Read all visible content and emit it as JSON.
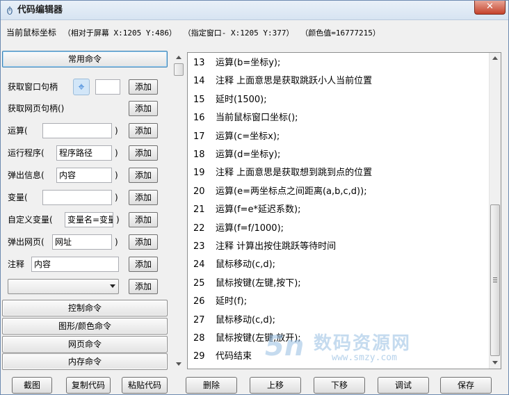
{
  "window": {
    "title": "代码编辑器",
    "icon": "app-icon",
    "close_label": "✕"
  },
  "coord_bar": {
    "label": "当前鼠标坐标",
    "screen": "（相对于屏幕 X:1205 Y:486）",
    "window": "（指定窗口- X:1205 Y:377）",
    "color": "（颜色值=16777215）"
  },
  "left_panel": {
    "groups": {
      "common": "常用命令",
      "control": "控制命令",
      "graphics": "图形/颜色命令",
      "web": "网页命令",
      "memory": "内存命令"
    },
    "add_label": "添加",
    "commands": {
      "get_window": {
        "label": "获取窗口句柄",
        "value": ""
      },
      "get_web": {
        "label": "获取网页句柄()"
      },
      "calc": {
        "label": "运算(",
        "value": "",
        "close": ")"
      },
      "run": {
        "label": "运行程序(",
        "value": "程序路径",
        "close": ")"
      },
      "popup": {
        "label": "弹出信息(",
        "value": "内容",
        "close": ")"
      },
      "variable": {
        "label": "变量(",
        "value": "",
        "close": ")"
      },
      "custom_var": {
        "label": "自定义变量(",
        "value": "变量名=变量",
        "close": ")"
      },
      "popup_web": {
        "label": "弹出网页(",
        "value": "网址",
        "close": ")"
      },
      "comment": {
        "label": "注释",
        "value": "内容"
      },
      "dropdown": {
        "value": ""
      }
    }
  },
  "editor": {
    "lines": [
      {
        "n": "13",
        "code": "运算(b=坐标y);"
      },
      {
        "n": "14",
        "code": "注释 上面意思是获取跳跃小人当前位置"
      },
      {
        "n": "15",
        "code": "延时(1500);"
      },
      {
        "n": "16",
        "code": "当前鼠标窗口坐标();"
      },
      {
        "n": "17",
        "code": "运算(c=坐标x);"
      },
      {
        "n": "18",
        "code": "运算(d=坐标y);"
      },
      {
        "n": "19",
        "code": "注释 上面意思是获取想到跳到点的位置"
      },
      {
        "n": "20",
        "code": "运算(e=两坐标点之间距离(a,b,c,d));"
      },
      {
        "n": "21",
        "code": "运算(f=e*延迟系数);"
      },
      {
        "n": "22",
        "code": "运算(f=f/1000);"
      },
      {
        "n": "23",
        "code": "注释 计算出按住跳跃等待时间"
      },
      {
        "n": "24",
        "code": "鼠标移动(c,d);"
      },
      {
        "n": "25",
        "code": "鼠标按键(左键,按下);"
      },
      {
        "n": "26",
        "code": "延时(f);"
      },
      {
        "n": "27",
        "code": "鼠标移动(c,d);"
      },
      {
        "n": "28",
        "code": "鼠标按键(左键,放开);"
      },
      {
        "n": "29",
        "code": "代码结束"
      }
    ]
  },
  "watermark": {
    "logo": "5n",
    "text": "数码资源网",
    "url": "www.smzy.com"
  },
  "bottom_buttons": {
    "screenshot": "截图",
    "copy": "复制代码",
    "paste": "粘贴代码",
    "delete": "删除",
    "up": "上移",
    "down": "下移",
    "debug": "调试",
    "save": "保存"
  }
}
